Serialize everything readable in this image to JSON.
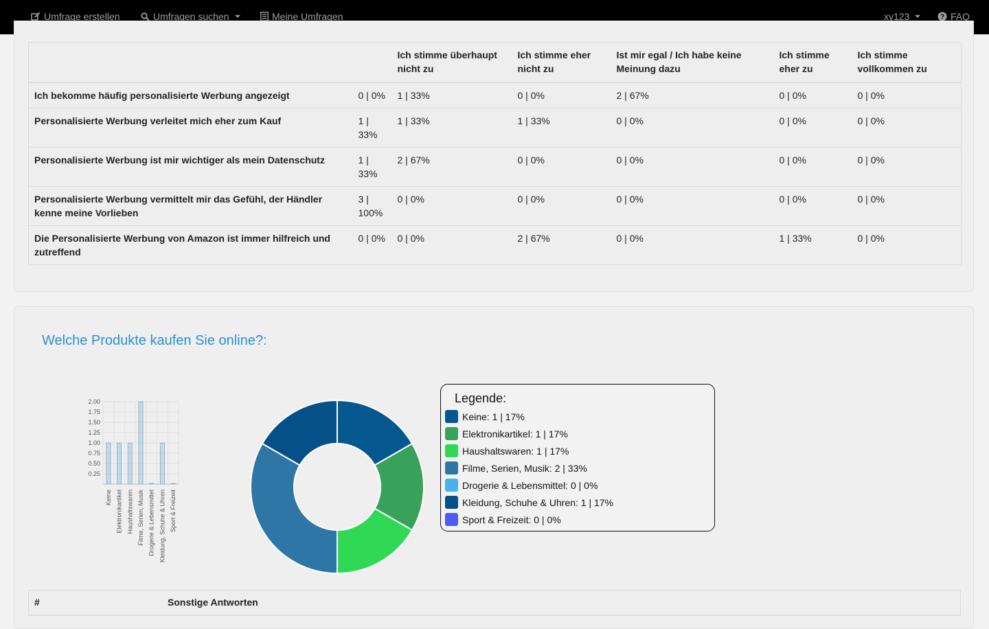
{
  "nav": {
    "create_label": "Umfrage erstellen",
    "search_label": "Umfragen suchen",
    "mine_label": "Meine Umfragen",
    "user_label": "xy123",
    "faq_label": "FAQ"
  },
  "matrix": {
    "headers": [
      "",
      "",
      "Ich stimme überhaupt nicht zu",
      "Ich stimme eher nicht zu",
      "Ist mir egal / Ich habe keine Meinung dazu",
      "Ich stimme eher zu",
      "Ich stimme vollkommen zu"
    ],
    "rows": [
      [
        "Ich bekomme häufig personalisierte Werbung angezeigt",
        "0 | 0%",
        "1 | 33%",
        "0 | 0%",
        "2 | 67%",
        "0 | 0%",
        "0 | 0%"
      ],
      [
        "Personalisierte Werbung verleitet mich eher zum Kauf",
        "1 | 33%",
        "1 | 33%",
        "1 | 33%",
        "0 | 0%",
        "0 | 0%",
        "0 | 0%"
      ],
      [
        "Personalisierte Werbung ist mir wichtiger als mein Datenschutz",
        "1 | 33%",
        "2 | 67%",
        "0 | 0%",
        "0 | 0%",
        "0 | 0%",
        "0 | 0%"
      ],
      [
        "Personalisierte Werbung vermittelt mir das Gefühl, der Händler kenne meine Vorlieben",
        "3 | 100%",
        "0 | 0%",
        "0 | 0%",
        "0 | 0%",
        "0 | 0%",
        "0 | 0%"
      ],
      [
        "Die Personalisierte Werbung von Amazon ist immer hilfreich und zutreffend",
        "0 | 0%",
        "0 | 0%",
        "2 | 67%",
        "0 | 0%",
        "1 | 33%",
        "0 | 0%"
      ]
    ]
  },
  "question": {
    "title": "Welche Produkte kaufen Sie online?:"
  },
  "chart_data": [
    {
      "type": "bar",
      "categories": [
        "Keine",
        "Elektronikartikel",
        "Haushaltswaren",
        "Filme, Serien, Musik",
        "Drogerie & Lebensmittel",
        "Kleidung, Schuhe & Uhren",
        "Sport & Freizeit"
      ],
      "values": [
        1,
        1,
        1,
        2,
        0,
        1,
        0
      ],
      "yticks": [
        "0.25",
        "0.50",
        "0.75",
        "1.00",
        "1.25",
        "1.50",
        "1.75",
        "2.00"
      ],
      "ylim": [
        0,
        2
      ],
      "grid": true,
      "bar_color": "#a9c8de"
    },
    {
      "type": "pie",
      "donut": true,
      "labels": [
        "Keine",
        "Elektronikartikel",
        "Haushaltswaren",
        "Filme, Serien, Musik",
        "Drogerie & Lebensmittel",
        "Kleidung, Schuhe & Uhren",
        "Sport & Freizeit"
      ],
      "values": [
        1,
        1,
        1,
        2,
        0,
        1,
        0
      ],
      "colors": [
        "#04578f",
        "#39a25a",
        "#2fd956",
        "#2e76a6",
        "#4ab0ee",
        "#06508a",
        "#4f5cf2"
      ]
    }
  ],
  "legend": {
    "title": "Legende:",
    "items": [
      {
        "label": "Keine: 1 | 17%",
        "color": "#04578f"
      },
      {
        "label": "Elektronikartikel: 1 | 17%",
        "color": "#39a25a"
      },
      {
        "label": "Haushaltswaren: 1 | 17%",
        "color": "#2fd956"
      },
      {
        "label": "Filme, Serien, Musik: 2 | 33%",
        "color": "#2e76a6"
      },
      {
        "label": "Drogerie & Lebensmittel: 0 | 0%",
        "color": "#4ab0ee"
      },
      {
        "label": "Kleidung, Schuhe & Uhren: 1 | 17%",
        "color": "#06508a"
      },
      {
        "label": "Sport & Freizeit: 0 | 0%",
        "color": "#4f5cf2"
      }
    ]
  },
  "other_answers": {
    "col_hash": "#",
    "col_label": "Sonstige Antworten"
  }
}
